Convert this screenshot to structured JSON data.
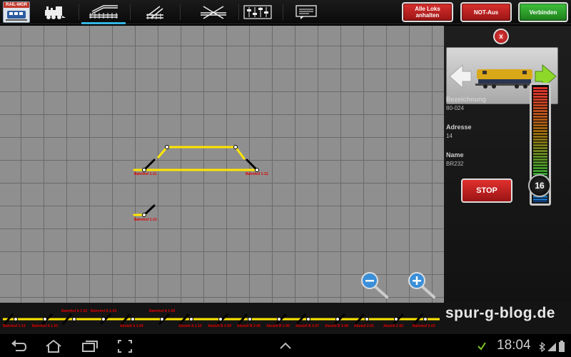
{
  "app": {
    "logo_text": "RAIL-MGR"
  },
  "toolbar": {
    "tools": [
      {
        "name": "locomotive-icon"
      },
      {
        "name": "track-layout-icon"
      },
      {
        "name": "turnout-icon"
      },
      {
        "name": "crossing-icon"
      },
      {
        "name": "sliders-icon"
      },
      {
        "name": "message-icon"
      }
    ],
    "stop_all_label": "Alle Loks anhalten",
    "emergency_label": "NOT-Aus",
    "connect_label": "Verbinden"
  },
  "layout": {
    "labels": [
      "Bahnhof 1-11",
      "Bahnhof 1-12",
      "Bahnhof 1-13"
    ]
  },
  "loco": {
    "bezeichnung_label": "Bezeichnung",
    "bezeichnung_value": "80-024",
    "adresse_label": "Adresse",
    "adresse_value": "14",
    "name_label": "Name",
    "name_value": "BR232",
    "speed": 16,
    "speed_max": 126,
    "stop_label": "STOP",
    "close_label": "x"
  },
  "strip": {
    "labels": [
      "Bahnhof 1-14",
      "Bahnhof A 1-01",
      "Bahnhof A 1-02",
      "Bahnhof A 1-03",
      "Abstell A 1-04",
      "Bahnhof A 1-05",
      "Abstell A 1-10",
      "Abstell B 2-04",
      "Abstell B 2-05",
      "Abstell B 2-06",
      "Abstell B 2-07",
      "Abstell B 2-08",
      "Abstell 2-01",
      "Abstell 2-02",
      "Bahnhof 2-03"
    ]
  },
  "watermark": "spur-g-blog.de",
  "status": {
    "time": "18:04"
  },
  "colors": {
    "track": "#ffe600",
    "accent": "#33b5e5",
    "red_button": "#c62020",
    "green_button": "#2ea82b"
  }
}
